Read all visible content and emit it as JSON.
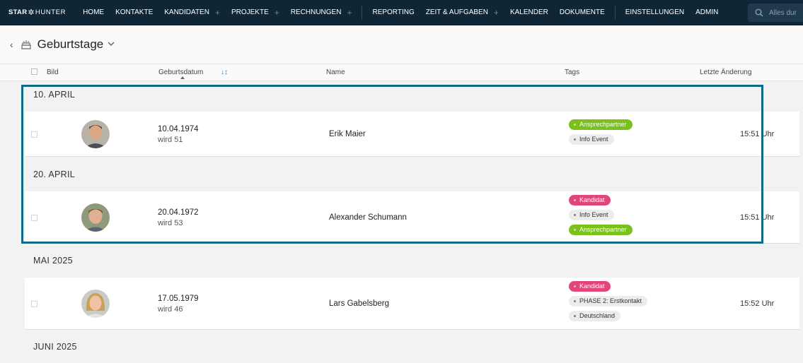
{
  "nav": {
    "logo_star": "STAR",
    "logo_hunter": "HUNTER",
    "items": [
      {
        "label": "HOME"
      },
      {
        "label": "KONTAKTE"
      },
      {
        "label": "KANDIDATEN",
        "plus": "+"
      },
      {
        "label": "PROJEKTE",
        "plus": "+"
      },
      {
        "label": "RECHNUNGEN",
        "plus": "+"
      },
      {
        "label": "REPORTING"
      },
      {
        "label": "ZEIT & AUFGABEN",
        "plus": "+"
      },
      {
        "label": "KALENDER"
      },
      {
        "label": "DOKUMENTE"
      },
      {
        "label": "EINSTELLUNGEN"
      },
      {
        "label": "ADMIN"
      }
    ],
    "search_placeholder": "Alles dur"
  },
  "page": {
    "back": "‹",
    "title": "Geburtstage",
    "caret": "⌄"
  },
  "columns": {
    "bild": "Bild",
    "geburtsdatum": "Geburtsdatum",
    "name": "Name",
    "tags": "Tags",
    "letzte_aenderung": "Letzte Änderung",
    "sort_glyph": "↓↕"
  },
  "groups": [
    {
      "label": "10. APRIL"
    },
    {
      "label": "20. APRIL"
    },
    {
      "label": "MAI 2025"
    },
    {
      "label": "JUNI 2025"
    }
  ],
  "rows": [
    {
      "date": "10.04.1974",
      "age": "wird 51",
      "name": "Erik Maier",
      "tags": [
        {
          "label": "Ansprechpartner",
          "color": "green"
        },
        {
          "label": "Info Event",
          "color": "grey"
        }
      ],
      "time": "15:51 Uhr"
    },
    {
      "date": "20.04.1972",
      "age": "wird 53",
      "name": "Alexander Schumann",
      "tags": [
        {
          "label": "Kandidat",
          "color": "pink"
        },
        {
          "label": "Info Event",
          "color": "grey"
        },
        {
          "label": "Ansprechpartner",
          "color": "green"
        }
      ],
      "time": "15:51 Uhr"
    },
    {
      "date": "17.05.1979",
      "age": "wird 46",
      "name": "Lars Gabelsberg",
      "tags": [
        {
          "label": "Kandidat",
          "color": "pink"
        },
        {
          "label": "PHASE 2: Erstkontakt",
          "color": "grey"
        },
        {
          "label": "Deutschland",
          "color": "grey"
        }
      ],
      "time": "15:52 Uhr"
    }
  ],
  "colors": {
    "nav_bg": "#0f2636",
    "tag_green": "#7bc11d",
    "tag_pink": "#e0457b",
    "highlight": "#0e6a86"
  }
}
